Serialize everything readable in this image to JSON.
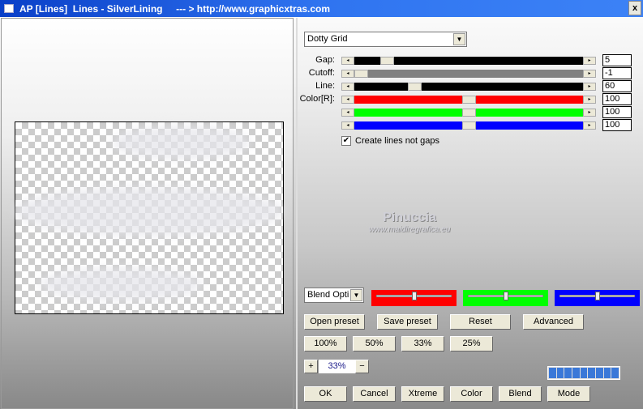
{
  "window": {
    "title": "AP [Lines]  Lines - SilverLining     --- > http://www.graphicxtras.com",
    "close": "x"
  },
  "preset_combo": {
    "value": "Dotty Grid"
  },
  "sliders": [
    {
      "label": "Gap:",
      "value": "5",
      "color": "#000000",
      "position": 0.12
    },
    {
      "label": "Cutoff:",
      "value": "-1",
      "color": "#808080",
      "position": 0.0
    },
    {
      "label": "Line:",
      "value": "60",
      "color": "#000000",
      "position": 0.25
    },
    {
      "label": "Color[R]:",
      "value": "100",
      "color": "#ff0000",
      "position": 0.5
    },
    {
      "label": "",
      "value": "100",
      "color": "#00ff00",
      "position": 0.5
    },
    {
      "label": "",
      "value": "100",
      "color": "#0000ff",
      "position": 0.5
    }
  ],
  "checkbox": {
    "label": "Create lines not gaps",
    "checked": true
  },
  "watermark": {
    "name": "Pinuccia",
    "site": "www.maidiregrafica.eu"
  },
  "blend_combo": {
    "value": "Blend Opti"
  },
  "color_sliders": [
    {
      "color": "#ff0000",
      "position": 0.5
    },
    {
      "color": "#00ff00",
      "position": 0.5
    },
    {
      "color": "#0000ff",
      "position": 0.5
    }
  ],
  "buttons": {
    "open_preset": "Open preset",
    "save_preset": "Save preset",
    "reset": "Reset",
    "advanced": "Advanced",
    "z100": "100%",
    "z50": "50%",
    "z33": "33%",
    "z25": "25%",
    "plus": "+",
    "minus": "−",
    "ok": "OK",
    "cancel": "Cancel",
    "xtreme": "Xtreme",
    "color": "Color",
    "blend": "Blend",
    "mode": "Mode"
  },
  "zoom_value": "33%",
  "progress_segments": 9
}
